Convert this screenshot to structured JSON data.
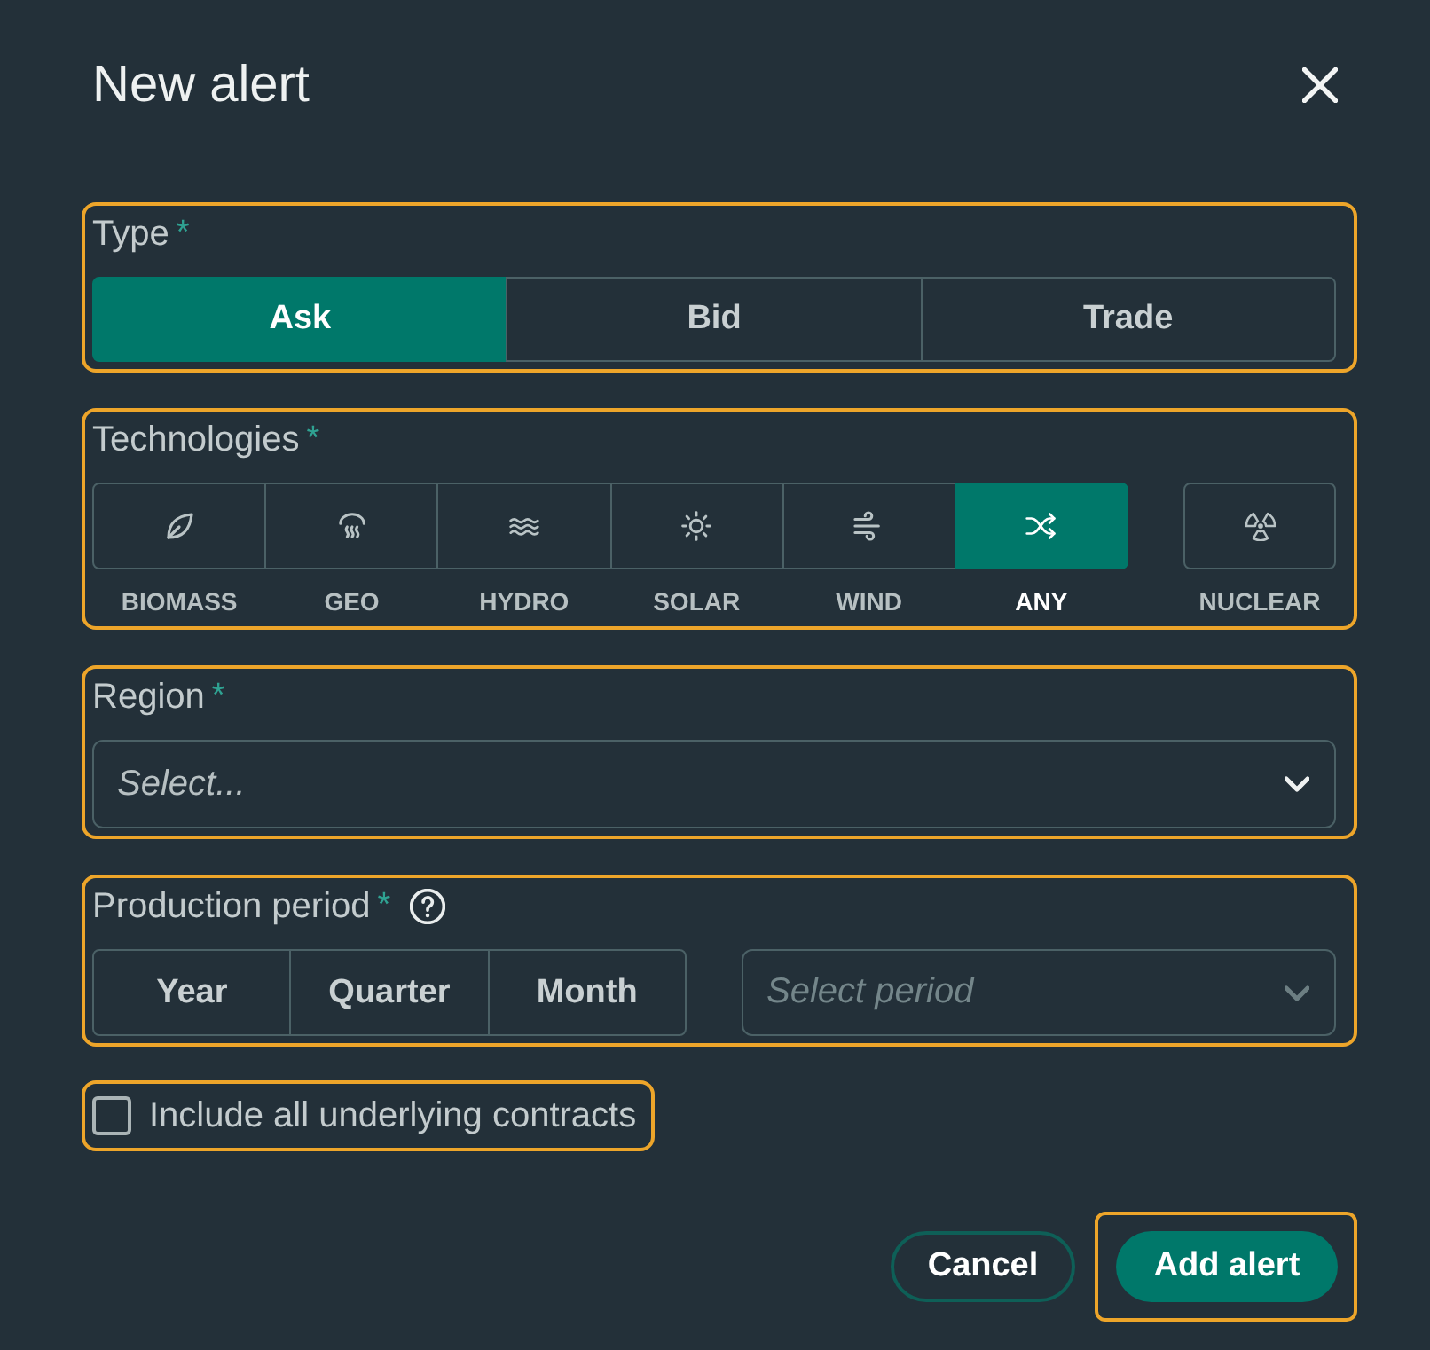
{
  "dialog": {
    "title": "New alert"
  },
  "type_field": {
    "label": "Type",
    "required_mark": "*",
    "highlighted": true,
    "options": [
      {
        "label": "Ask",
        "selected": true
      },
      {
        "label": "Bid",
        "selected": false
      },
      {
        "label": "Trade",
        "selected": false
      }
    ]
  },
  "technologies": {
    "label": "Technologies",
    "required_mark": "*",
    "highlighted": true,
    "groups": [
      {
        "options": [
          {
            "label": "BIOMASS",
            "selected": false
          },
          {
            "label": "GEO",
            "selected": false
          },
          {
            "label": "HYDRO",
            "selected": false
          },
          {
            "label": "SOLAR",
            "selected": false
          },
          {
            "label": "WIND",
            "selected": false
          },
          {
            "label": "ANY",
            "selected": true
          }
        ]
      },
      {
        "options": [
          {
            "label": "NUCLEAR",
            "selected": false
          }
        ]
      }
    ]
  },
  "region": {
    "label": "Region",
    "required_mark": "*",
    "highlighted": true,
    "placeholder": "Select..."
  },
  "production_period": {
    "label": "Production period",
    "required_mark": "*",
    "highlighted": true,
    "options": [
      {
        "label": "Year",
        "selected": false
      },
      {
        "label": "Quarter",
        "selected": false
      },
      {
        "label": "Month",
        "selected": false
      }
    ],
    "period_select": {
      "placeholder": "Select period",
      "disabled": true
    }
  },
  "include_contracts": {
    "label": "Include all underlying contracts",
    "checked": false,
    "highlighted": true
  },
  "buttons": [
    {
      "label": "Cancel",
      "kind": "secondary",
      "highlighted": false
    },
    {
      "label": "Add alert",
      "kind": "primary",
      "highlighted": true
    }
  ]
}
